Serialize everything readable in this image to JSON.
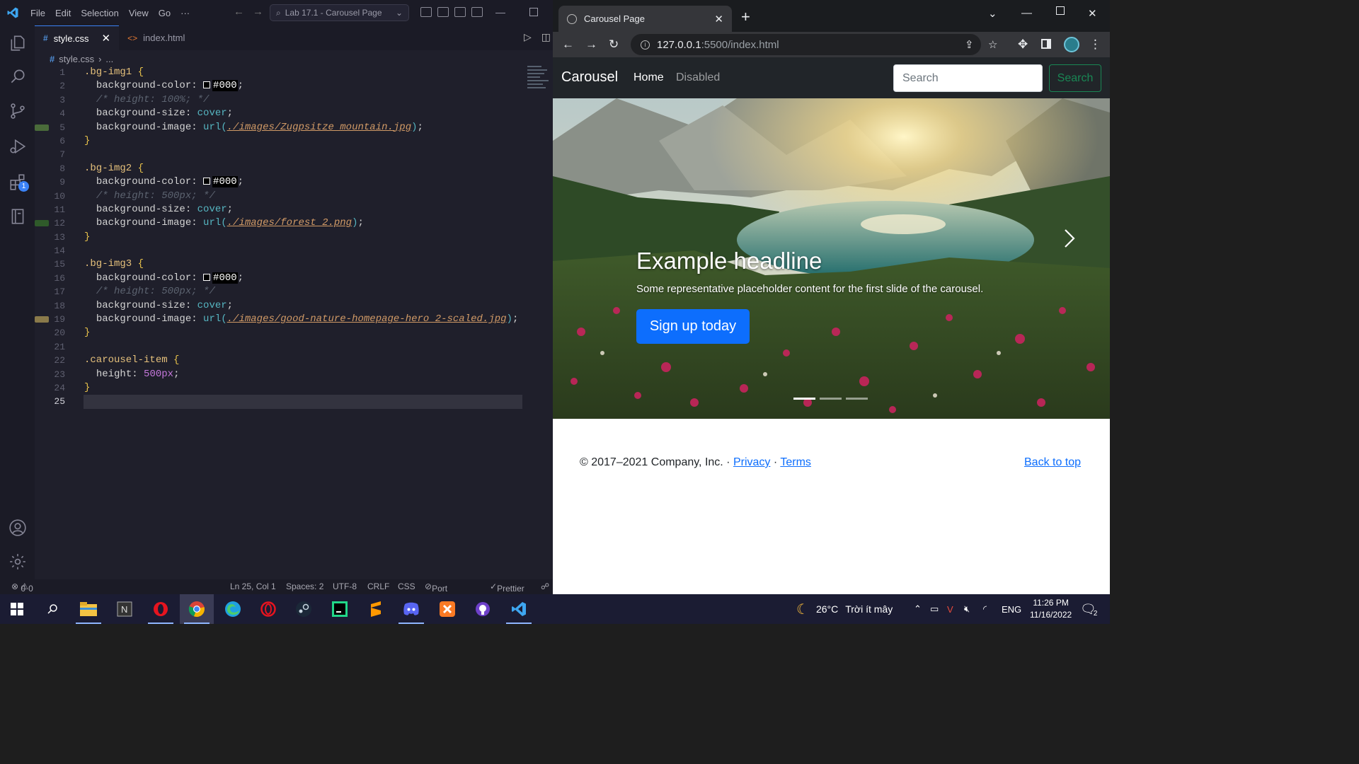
{
  "vscode": {
    "menu": [
      "File",
      "Edit",
      "Selection",
      "View",
      "Go",
      "···"
    ],
    "command_center": "Lab 17.1 - Carousel Page",
    "tabs": [
      {
        "label": "style.css",
        "icon": "#",
        "active": true
      },
      {
        "label": "index.html",
        "icon": "<>",
        "active": false
      }
    ],
    "breadcrumb": {
      "file": "style.css",
      "rest": "..."
    },
    "status": {
      "errors": "0",
      "warnings": "0",
      "position": "Ln 25, Col 1",
      "spaces": "Spaces: 2",
      "encoding": "UTF-8",
      "eol": "CRLF",
      "language": "CSS",
      "port": "Port : 5500",
      "prettier": "Prettier"
    },
    "extension_badge": "1"
  },
  "code_lines": [
    {
      "n": "1",
      "html": "<span class=\"sel\">.bg-img1</span> <span class=\"brace\">{</span>"
    },
    {
      "n": "2",
      "html": "  <span class=\"prop\">background-color</span>: <span class=\"swatch\"></span><span class=\"hex\">#000</span>;"
    },
    {
      "n": "3",
      "html": "  <span class=\"cmt\">/* height: 100%; */</span>"
    },
    {
      "n": "4",
      "html": "  <span class=\"prop\">background-size</span>: <span class=\"val\">cover</span>;"
    },
    {
      "n": "5",
      "html": "  <span class=\"prop\">background-image</span>: <span class=\"urlfn\">url(</span><span class=\"urlstr\">./images/Zugpsitze_mountain.jpg</span><span class=\"urlfn\">)</span>;"
    },
    {
      "n": "6",
      "html": "<span class=\"brace\">}</span>"
    },
    {
      "n": "7",
      "html": ""
    },
    {
      "n": "8",
      "html": "<span class=\"sel\">.bg-img2</span> <span class=\"brace\">{</span>"
    },
    {
      "n": "9",
      "html": "  <span class=\"prop\">background-color</span>: <span class=\"swatch\"></span><span class=\"hex\">#000</span>;"
    },
    {
      "n": "10",
      "html": "  <span class=\"cmt\">/* height: 500px; */</span>"
    },
    {
      "n": "11",
      "html": "  <span class=\"prop\">background-size</span>: <span class=\"val\">cover</span>;"
    },
    {
      "n": "12",
      "html": "  <span class=\"prop\">background-image</span>: <span class=\"urlfn\">url(</span><span class=\"urlstr\">./images/forest_2.png</span><span class=\"urlfn\">)</span>;"
    },
    {
      "n": "13",
      "html": "<span class=\"brace\">}</span>"
    },
    {
      "n": "14",
      "html": ""
    },
    {
      "n": "15",
      "html": "<span class=\"sel\">.bg-img3</span> <span class=\"brace\">{</span>"
    },
    {
      "n": "16",
      "html": "  <span class=\"prop\">background-color</span>: <span class=\"swatch\"></span><span class=\"hex\">#000</span>;"
    },
    {
      "n": "17",
      "html": "  <span class=\"cmt\">/* height: 500px; */</span>"
    },
    {
      "n": "18",
      "html": "  <span class=\"prop\">background-size</span>: <span class=\"val\">cover</span>;"
    },
    {
      "n": "19",
      "html": "  <span class=\"prop\">background-image</span>: <span class=\"urlfn\">url(</span><span class=\"urlstr\">./images/good-nature-homepage-hero_2-scaled.jpg</span><span class=\"urlfn\">)</span>;"
    },
    {
      "n": "20",
      "html": "<span class=\"brace\">}</span>"
    },
    {
      "n": "21",
      "html": ""
    },
    {
      "n": "22",
      "html": "<span class=\"sel\">.carousel-item</span> <span class=\"brace\">{</span>"
    },
    {
      "n": "23",
      "html": "  <span class=\"prop\">height</span>: <span class=\"num\">500px</span>;"
    },
    {
      "n": "24",
      "html": "<span class=\"brace\">}</span>"
    },
    {
      "n": "25",
      "html": ""
    }
  ],
  "chrome": {
    "tab_title": "Carousel Page",
    "url_host": "127.0.0.1",
    "url_path": ":5500/index.html"
  },
  "page": {
    "brand": "Carousel",
    "nav_home": "Home",
    "nav_disabled": "Disabled",
    "search_placeholder": "Search",
    "search_button": "Search",
    "headline": "Example headline",
    "subtext": "Some representative placeholder content for the first slide of the carousel.",
    "cta": "Sign up today",
    "footer_copy": "© 2017–2021 Company, Inc. · ",
    "privacy": "Privacy",
    "separator": " · ",
    "terms": "Terms",
    "back_to_top": "Back to top"
  },
  "taskbar": {
    "weather_temp": "26°C",
    "weather_desc": "Trời ít mây",
    "lang": "ENG",
    "time": "11:26 PM",
    "date": "11/16/2022",
    "notif_count": "2"
  },
  "colors": {
    "accent": "#0d6efd",
    "success": "#198754",
    "navbar": "#212529"
  }
}
